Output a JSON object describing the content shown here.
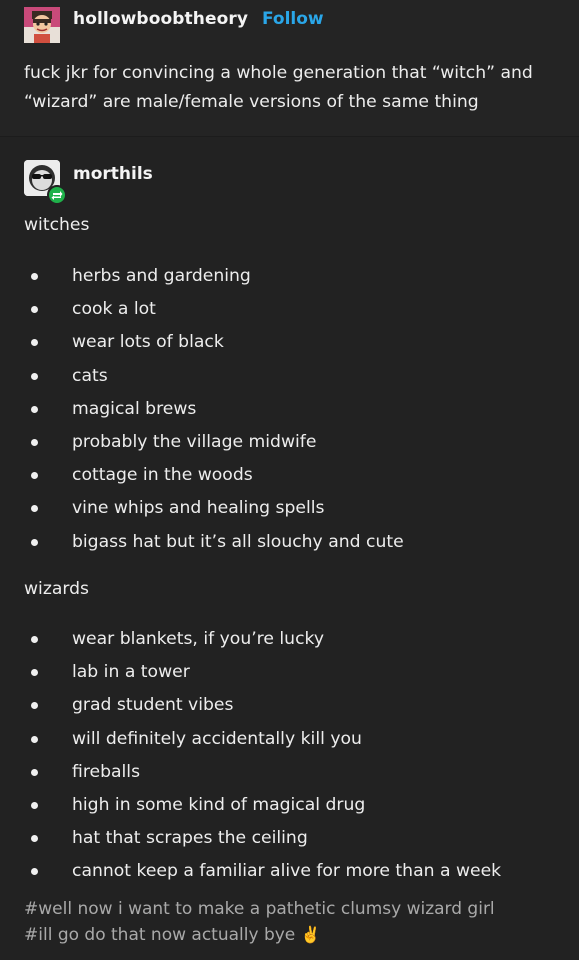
{
  "original_post": {
    "username": "hollowboobtheory",
    "follow_label": "Follow",
    "text": "fuck jkr for convincing a whole generation that “witch” and “wizard” are male/female versions of the same thing"
  },
  "reblog": {
    "username": "morthils",
    "witches_heading": "witches",
    "witches": [
      "herbs and gardening",
      "cook a lot",
      "wear lots of black",
      "cats",
      "magical brews",
      "probably the village midwife",
      "cottage in the woods",
      "vine whips and healing spells",
      "bigass hat but it’s all slouchy and cute"
    ],
    "wizards_heading": "wizards",
    "wizards": [
      "wear blankets, if you’re lucky",
      "lab in a tower",
      "grad student vibes",
      "will definitely accidentally kill you",
      "fireballs",
      "high in some kind of magical drug",
      "hat that scrapes the ceiling",
      "cannot keep a familiar alive for more than a week"
    ]
  },
  "tags": {
    "tag1": "#well now i want to make a pathetic clumsy wizard girl",
    "tag2": "#ill go do that now actually bye",
    "tag2_emoji": "✌️"
  },
  "colors": {
    "follow": "#2aa6e8",
    "background": "#222222",
    "tag_text": "#a9a9a9",
    "reblog_badge": "#1fb14a"
  },
  "icons": {
    "avatar1": "cartoon-character-avatar",
    "avatar2": "sunglasses-face-avatar",
    "badge": "reblog-icon"
  }
}
